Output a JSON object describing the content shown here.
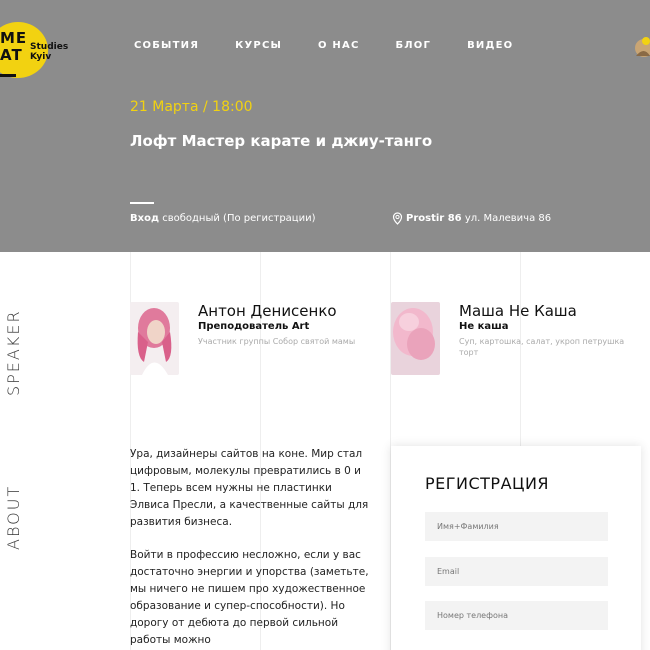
{
  "logo": {
    "letters": "ME\nAT",
    "text_line1": "Studies",
    "text_line2": "Kyiv"
  },
  "nav": [
    "СОБЫТИЯ",
    "КУРСЫ",
    "О НАС",
    "БЛОГ",
    "ВИДЕО"
  ],
  "event": {
    "date": "21 Марта / 18:00",
    "title": "Лофт Мастер карате и джиу-танго",
    "entry_label": "Вход",
    "entry_value": "свободный (По регистрации)",
    "location_name": "Prostir 86",
    "location_address": "ул. Малевича 86"
  },
  "side_labels": {
    "speaker": "SPEAKER",
    "about": "ABOUT"
  },
  "speakers": [
    {
      "name": "Антон Денисенко",
      "role": "Преподователь Art",
      "desc": "Участник группы Собор святой мамы"
    },
    {
      "name": "Маша Не Каша",
      "role": "Не каша",
      "desc": "Суп, картошка, салат, укроп петрушка торт"
    }
  ],
  "about": {
    "paragraphs": [
      "Ура, дизайнеры сайтов на коне. Мир стал цифровым, молекулы превратились в 0 и 1. Теперь всем нужны не пластинки Элвиса Пресли, а качественные сайты для развития бизнеса.",
      "Войти в профессию несложно, если у вас достаточно энергии и упорства (заметьте, мы ничего не пишем про художественное образование и супер-способности). Но дорогу от дебюта до первой сильной работы можно"
    ]
  },
  "registration": {
    "title": "РЕГИСТРАЦИЯ",
    "name_placeholder": "Имя+Фамилия",
    "email_placeholder": "Email",
    "phone_placeholder": "Номер телефона"
  },
  "colors": {
    "hero_bg": "#8c8c8c",
    "accent": "#f2d211"
  }
}
